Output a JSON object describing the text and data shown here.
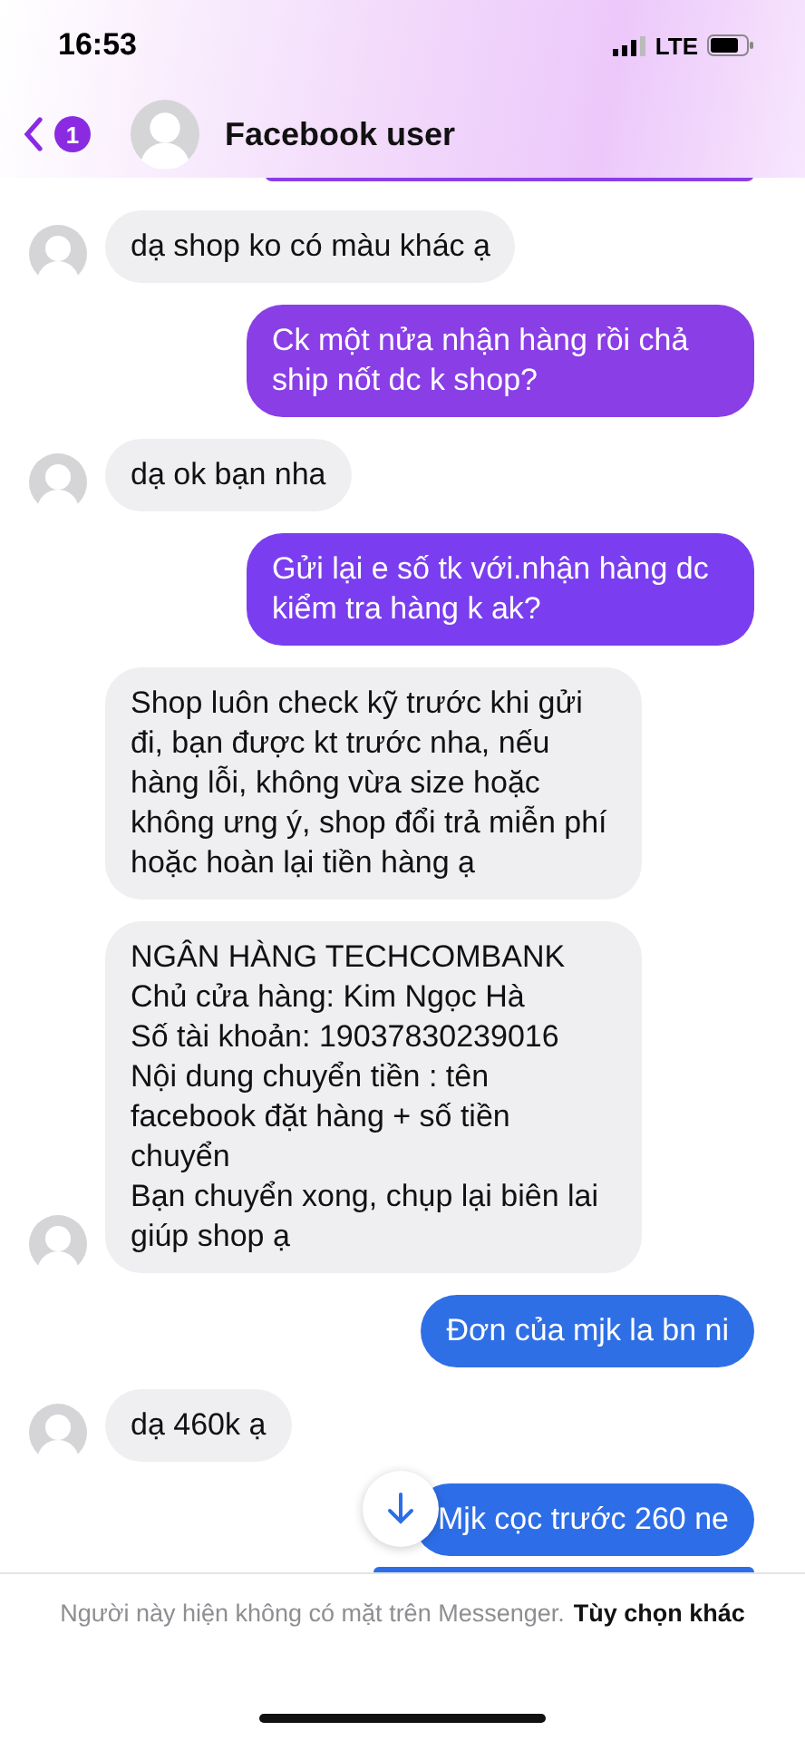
{
  "status_bar": {
    "time": "16:53",
    "network": "LTE"
  },
  "header": {
    "unread_badge": "1",
    "title": "Facebook user"
  },
  "messages": [
    {
      "kind": "received",
      "text": "dạ shop ko có màu khác ạ",
      "avatar": true
    },
    {
      "kind": "sent",
      "text": "Ck một nửa nhận hàng rồi chả ship nốt dc k shop?",
      "color": "#8a3ee6"
    },
    {
      "kind": "received",
      "text": "dạ ok bạn nha",
      "avatar": true
    },
    {
      "kind": "sent",
      "text": "Gửi lại e số tk với.nhận hàng dc kiểm tra hàng k ak?",
      "color": "#7a3ef0"
    },
    {
      "kind": "received",
      "text": "Shop luôn check kỹ trước khi gửi đi, bạn được kt trước nha, nếu hàng lỗi, không vừa size hoặc không ưng ý, shop đổi trả miễn phí hoặc hoàn lại tiền hàng ạ",
      "avatar": false
    },
    {
      "kind": "received",
      "lines": [
        "NGÂN HÀNG TECHCOMBANK",
        "Chủ cửa hàng: Kim Ngọc Hà",
        "Số tài khoản: 19037830239016",
        "Nội dung chuyển tiền : tên facebook đặt hàng + số tiền chuyển",
        "Bạn chuyển xong, chụp lại biên lai giúp shop ạ"
      ],
      "avatar": true
    },
    {
      "kind": "sent",
      "text": "Đơn của mjk la bn ni",
      "color": "#2f6fe6"
    },
    {
      "kind": "received",
      "text": "dạ 460k ạ",
      "avatar": true
    },
    {
      "kind": "sent",
      "text": "Mjk cọc trước 260 ne",
      "color": "#2d6ee8"
    }
  ],
  "footer": {
    "notice": "Người này hiện không có mặt trên Messenger.",
    "link": "Tùy chọn khác"
  }
}
